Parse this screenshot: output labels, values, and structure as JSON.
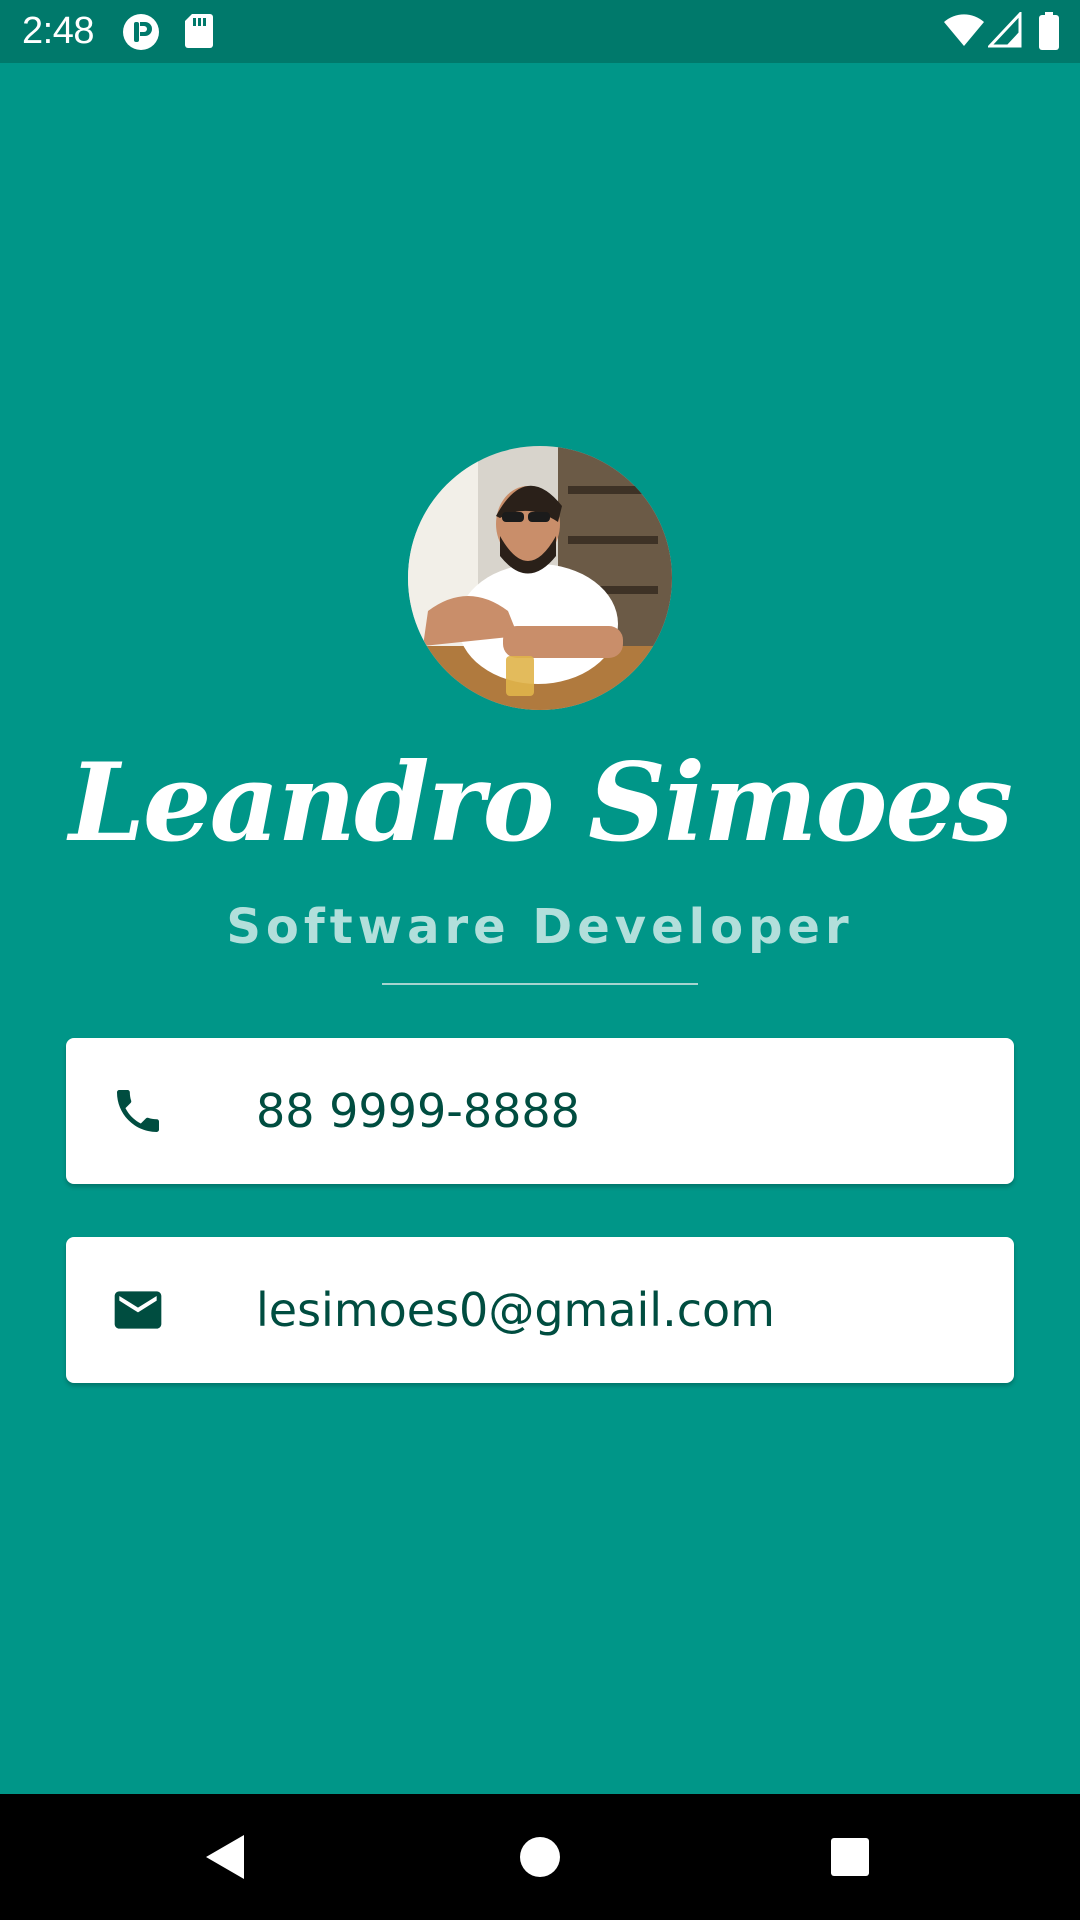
{
  "status_bar": {
    "time": "2:48",
    "left_icons": [
      "at-sign-badge-icon",
      "sd-card-icon"
    ],
    "right_icons": [
      "wifi-icon",
      "cellular-signal-icon",
      "battery-icon"
    ]
  },
  "profile": {
    "avatar_icon": "profile-photo",
    "name": "Leandro Simoes",
    "title": "Software Developer"
  },
  "contacts": {
    "phone": {
      "icon": "phone-icon",
      "value": "88 9999-8888"
    },
    "email": {
      "icon": "mail-icon",
      "value": "lesimoes0@gmail.com"
    }
  },
  "nav_bar": {
    "buttons": [
      "back-icon",
      "home-icon",
      "recents-icon"
    ]
  },
  "colors": {
    "background": "#009688",
    "status_bar": "#00796b",
    "card": "#ffffff",
    "card_text": "#004d40",
    "subtitle": "#b2dfdb",
    "nav_bar": "#000000"
  }
}
